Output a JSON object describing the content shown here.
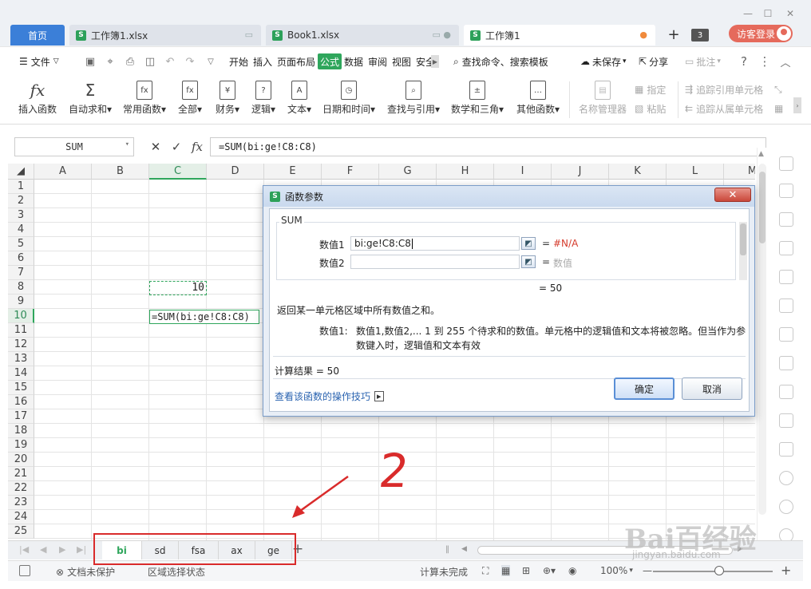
{
  "tabs": {
    "home": "首页",
    "docs": [
      {
        "name": "工作簿1.xlsx"
      },
      {
        "name": "Book1.xlsx"
      },
      {
        "name": "工作簿1"
      }
    ],
    "tab_count": "3",
    "guest_login": "访客登录"
  },
  "menu": {
    "file": "文件",
    "items": [
      "开始",
      "插入",
      "页面布局",
      "公式",
      "数据",
      "审阅",
      "视图",
      "安全"
    ],
    "active": "公式",
    "search": "查找命令、搜索模板",
    "unsaved": "未保存",
    "share": "分享",
    "comment": "批注"
  },
  "ribbon": {
    "insert_function": "插入函数",
    "autosum": "自动求和",
    "common_functions": "常用函数",
    "all": "全部",
    "finance": "财务",
    "logic": "逻辑",
    "text": "文本",
    "datetime": "日期和时间",
    "lookup": "查找与引用",
    "math": "数学和三角",
    "other": "其他函数",
    "name_manager": "名称管理器",
    "specify": "指定",
    "paste": "粘贴",
    "trace_precedents": "追踪引用单元格",
    "trace_dependents": "追踪从属单元格"
  },
  "formula_bar": {
    "name_box": "SUM",
    "formula": "=SUM(bi:ge!C8:C8)"
  },
  "grid": {
    "columns": [
      "A",
      "B",
      "C",
      "D",
      "E",
      "F",
      "G",
      "H",
      "I",
      "J",
      "K",
      "L",
      "M"
    ],
    "selected_column": "C",
    "rows": [
      "1",
      "2",
      "3",
      "4",
      "5",
      "6",
      "7",
      "8",
      "9",
      "10",
      "11",
      "12",
      "13",
      "14",
      "15",
      "16",
      "17",
      "18",
      "19",
      "20",
      "21",
      "22",
      "23",
      "24",
      "25"
    ],
    "selected_row": "10",
    "c8_value": "10",
    "c10_value": "=SUM(bi:ge!C8:C8)"
  },
  "dialog": {
    "title": "函数参数",
    "function_name": "SUM",
    "arg1_label": "数值1",
    "arg1_value": "bi:ge!C8:C8",
    "arg1_result": "#N/A",
    "arg2_label": "数值2",
    "arg2_result": "数值",
    "eq": "=",
    "total": "= 50",
    "description": "返回某一单元格区域中所有数值之和。",
    "param_label": "数值1:",
    "param_desc_line1": "数值1,数值2,... 1 到 255 个待求和的数值。单元格中的逻辑值和文本将被忽略。但当作为参",
    "param_desc_line2": "数键入时，逻辑值和文本有效",
    "calc_result": "计算结果 = 50",
    "help_link": "查看该函数的操作技巧",
    "ok": "确定",
    "cancel": "取消"
  },
  "sheets": {
    "tabs": [
      "bi",
      "sd",
      "fsa",
      "ax",
      "ge"
    ],
    "active": "bi",
    "add": "+"
  },
  "status": {
    "protect": "文档未保护",
    "mode": "区域选择状态",
    "calc": "计算未完成",
    "zoom": "100%"
  },
  "annotation": {
    "number": "2"
  },
  "watermark": {
    "main": "Bai百经验",
    "sub": "jingyan.baidu.com"
  },
  "colors": {
    "accent": "#2fa65c",
    "home_tab": "#3b7fd8",
    "annotation_red": "#d92b2b",
    "error_red": "#d53b2c"
  }
}
